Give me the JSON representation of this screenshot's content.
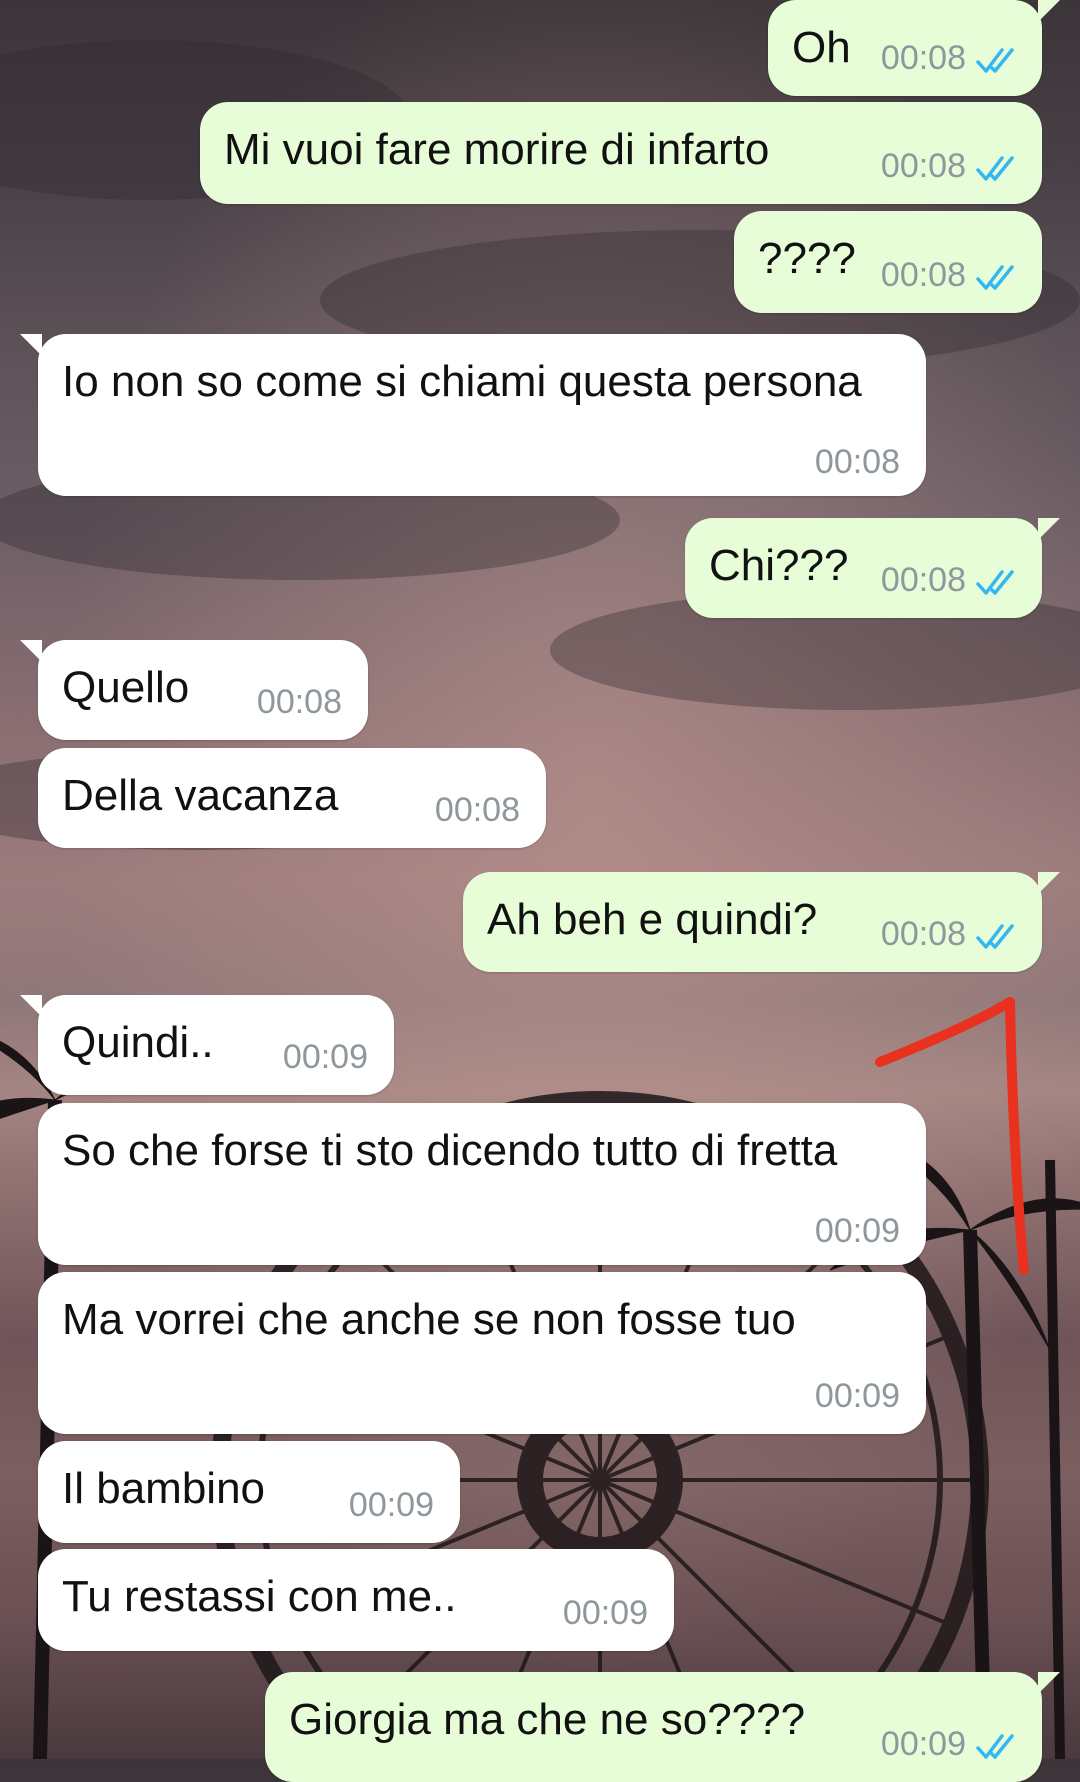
{
  "messages": [
    {
      "dir": "out",
      "text": "Oh",
      "time": "00:08",
      "read": true
    },
    {
      "dir": "out",
      "text": "Mi vuoi fare morire di infarto",
      "time": "00:08",
      "read": true
    },
    {
      "dir": "out",
      "text": "????",
      "time": "00:08",
      "read": true
    },
    {
      "dir": "in",
      "text": "Io non so come si chiami questa persona",
      "time": "00:08"
    },
    {
      "dir": "out",
      "text": "Chi???",
      "time": "00:08",
      "read": true
    },
    {
      "dir": "in",
      "text": "Quello",
      "time": "00:08"
    },
    {
      "dir": "in",
      "text": "Della vacanza",
      "time": "00:08"
    },
    {
      "dir": "out",
      "text": "Ah beh e quindi?",
      "time": "00:08",
      "read": true
    },
    {
      "dir": "in",
      "text": "Quindi..",
      "time": "00:09"
    },
    {
      "dir": "in",
      "text": "So che forse ti sto dicendo tutto di fretta",
      "time": "00:09"
    },
    {
      "dir": "in",
      "text": "Ma vorrei che anche se non fosse tuo",
      "time": "00:09"
    },
    {
      "dir": "in",
      "text": "Il bambino",
      "time": "00:09"
    },
    {
      "dir": "in",
      "text": "Tu restassi con me..",
      "time": "00:09"
    },
    {
      "dir": "out",
      "text": "Giorgia ma che ne so????",
      "time": "00:09",
      "read": true
    }
  ],
  "colors": {
    "outgoing_bubble": "#e6fdd8",
    "incoming_bubble": "#ffffff",
    "read_ticks": "#34b7f1",
    "annotation_arrow": "#e8321f"
  },
  "icons": {
    "read_receipt": "double-check-icon",
    "annotation": "red-arrow-annotation"
  },
  "background": "sunset sky with ferris wheel and palm trees wallpaper"
}
